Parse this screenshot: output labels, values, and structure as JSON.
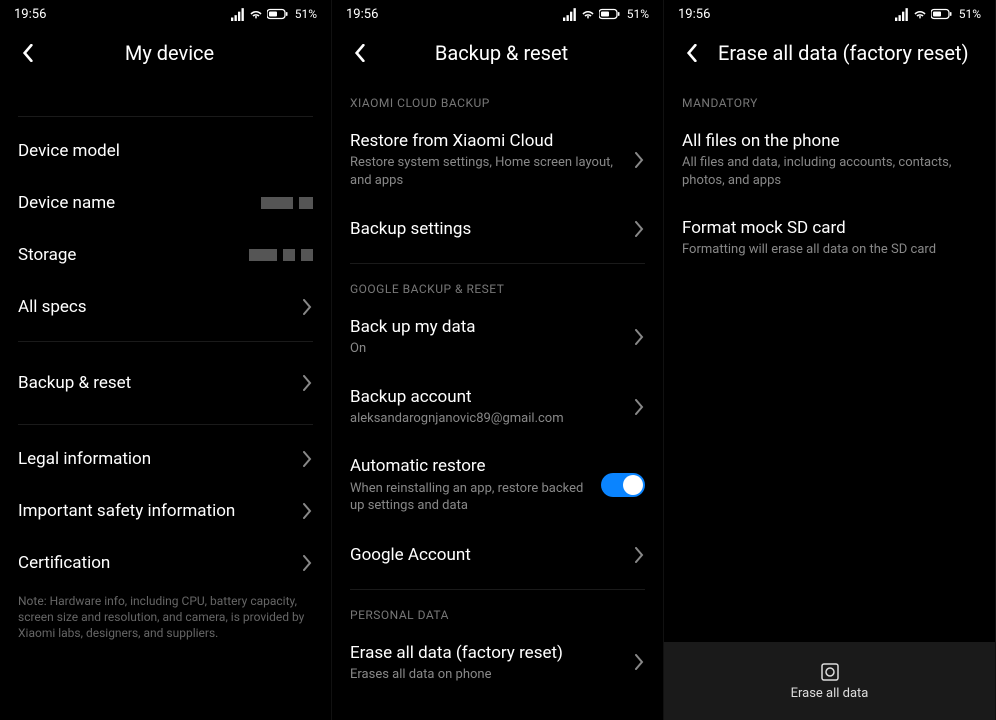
{
  "status": {
    "time": "19:56",
    "battery_pct": "51%"
  },
  "screen1": {
    "title": "My device",
    "rows": {
      "device_model": "Device model",
      "device_name": "Device name",
      "storage": "Storage",
      "all_specs": "All specs",
      "backup_reset": "Backup & reset",
      "legal": "Legal information",
      "safety": "Important safety information",
      "certification": "Certification"
    },
    "footnote": "Note: Hardware info, including CPU, battery capacity, screen size and resolution, and camera, is provided by Xiaomi labs, designers, and suppliers."
  },
  "screen2": {
    "title": "Backup & reset",
    "sections": {
      "xiaomi": "XIAOMI CLOUD BACKUP",
      "google": "GOOGLE BACKUP & RESET",
      "personal": "PERSONAL DATA"
    },
    "rows": {
      "restore_cloud": {
        "title": "Restore from Xiaomi Cloud",
        "sub": "Restore system settings, Home screen layout, and apps"
      },
      "backup_settings": {
        "title": "Backup settings"
      },
      "backup_my_data": {
        "title": "Back up my data",
        "sub": "On"
      },
      "backup_account": {
        "title": "Backup account",
        "sub": "aleksandarognjanovic89@gmail.com"
      },
      "auto_restore": {
        "title": "Automatic restore",
        "sub": "When reinstalling an app, restore backed up settings and data"
      },
      "google_account": {
        "title": "Google Account"
      },
      "erase": {
        "title": "Erase all data (factory reset)",
        "sub": "Erases all data on phone"
      }
    }
  },
  "screen3": {
    "title": "Erase all data (factory reset)",
    "sections": {
      "mandatory": "MANDATORY"
    },
    "rows": {
      "all_files": {
        "title": "All files on the phone",
        "sub": "All files and data, including accounts, contacts, photos, and apps"
      },
      "format_sd": {
        "title": "Format mock SD card",
        "sub": "Formatting will erase all data on the SD card"
      }
    },
    "action_label": "Erase all data"
  }
}
